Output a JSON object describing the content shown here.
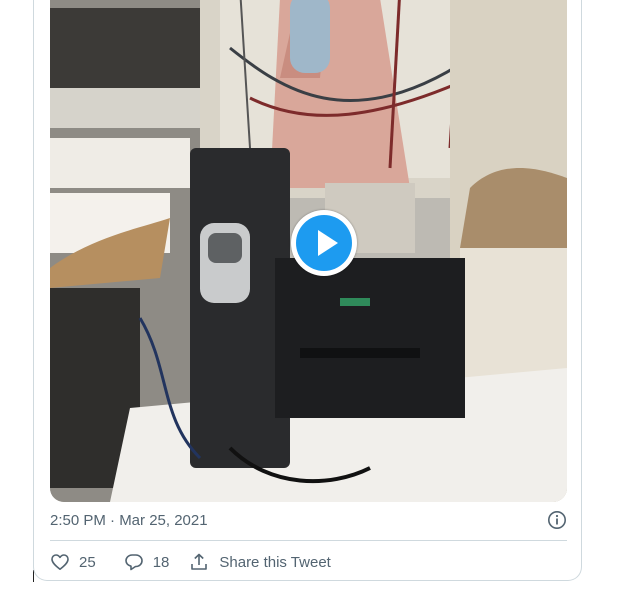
{
  "tweet": {
    "media": {
      "type": "video",
      "play_button_label": "Play video"
    },
    "timestamp": "2:50 PM · Mar 25, 2021",
    "info_icon": "info-circle-icon",
    "actions": {
      "like": {
        "icon": "heart-icon",
        "count": "25"
      },
      "reply": {
        "icon": "speech-bubble-icon",
        "count": "18"
      },
      "share": {
        "icon": "share-upload-icon",
        "label": "Share this Tweet"
      }
    }
  },
  "colors": {
    "accent": "#1d9bf0",
    "secondary_text": "#536471",
    "border": "#cfd9de"
  }
}
